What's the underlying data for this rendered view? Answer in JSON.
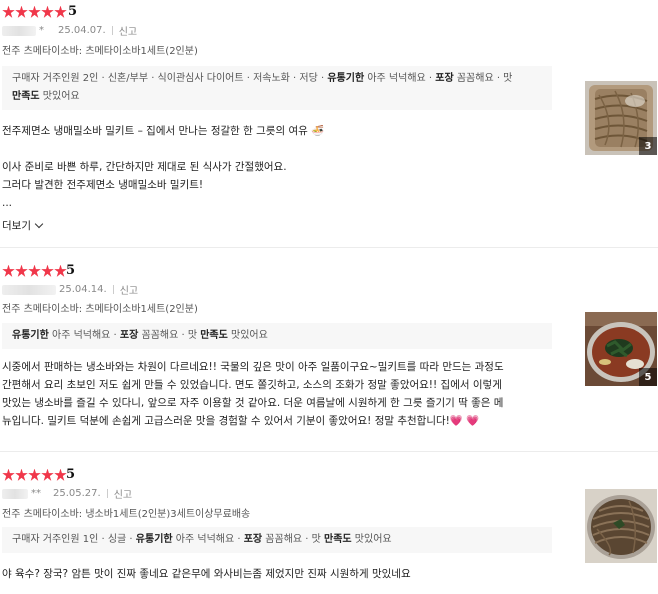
{
  "reviews": [
    {
      "rating": "5",
      "stars": 5,
      "user": "*",
      "date": "25.04.07.",
      "report": "신고",
      "option": "전주 츠메타이소바: 츠메타이소바1세트(2인분)",
      "tags_line1": [
        {
          "text": "구매자 거주인원 2인 · 신혼/부부 · 식이관심사 다이어트 · 저속노화 · 저당 · ",
          "bold": false
        },
        {
          "text": "유통기한",
          "bold": true
        },
        {
          "text": " 아주 넉넉해요 · ",
          "bold": false
        },
        {
          "text": "포장",
          "bold": true
        },
        {
          "text": " 꼼꼼해요 · 맛",
          "bold": false
        }
      ],
      "tags_line2": [
        {
          "text": "만족도",
          "bold": true
        },
        {
          "text": " 맛있어요",
          "bold": false
        }
      ],
      "body": [
        "전주제면소 냉매밀소바 밀키트 – 집에서 만나는 정갈한 한 그릇의 여유 🍜",
        "",
        "이사 준비로 바쁜 하루, 간단하지만 제대로 된 식사가 간절했어요.",
        "그러다 발견한 전주제면소 냉매밀소바 밀키트!",
        "..."
      ],
      "more": "더보기",
      "photo_count": "3"
    },
    {
      "rating": "5",
      "stars": 5,
      "user": "",
      "date": "25.04.14.",
      "report": "신고",
      "option": "전주 츠메타이소바: 츠메타이소바1세트(2인분)",
      "tags_line1": [
        {
          "text": "유통기한",
          "bold": true
        },
        {
          "text": " 아주 넉넉해요 · ",
          "bold": false
        },
        {
          "text": "포장",
          "bold": true
        },
        {
          "text": " 꼼꼼해요 · 맛 ",
          "bold": false
        },
        {
          "text": "만족도",
          "bold": true
        },
        {
          "text": " 맛있어요",
          "bold": false
        }
      ],
      "body": [
        "시중에서 판매하는 냉소바와는 차원이 다르네요!! 국물의 깊은 맛이 아주 일품이구요~밀키트를 따라 만드는 과정도",
        "간편해서 요리 초보인 저도 쉽게 만들 수 있었습니다. 면도 쫄깃하고, 소스의 조화가 정말 좋았어요!! 집에서 이렇게",
        "맛있는 냉소바를 즐길 수 있다니, 앞으로 자주 이용할 것 같아요. 더운 여름날에 시원하게 한 그릇 즐기기 딱 좋은 메",
        "뉴입니다. 밀키트 덕분에 손쉽게 고급스러운 맛을 경험할 수 있어서 기분이 좋았어요! 정말 추천합니다!"
      ],
      "hearts": "💗 💗",
      "photo_count": "5"
    },
    {
      "rating": "5",
      "stars": 5,
      "user": "**",
      "date": "25.05.27.",
      "report": "신고",
      "option": "전주 츠메타이소바: 냉소바1세트(2인분)3세트이상무료배송",
      "tags_line1": [
        {
          "text": "구매자 거주인원 1인 · 싱글 · ",
          "bold": false
        },
        {
          "text": "유통기한",
          "bold": true
        },
        {
          "text": " 아주 넉넉해요 · ",
          "bold": false
        },
        {
          "text": "포장",
          "bold": true
        },
        {
          "text": " 꼼꼼해요 · 맛 ",
          "bold": false
        },
        {
          "text": "만족도",
          "bold": true
        },
        {
          "text": " 맛있어요",
          "bold": false
        }
      ],
      "body": [
        "야 육수? 장국? 암튼 맛이 진짜 좋네요 같은무에 와사비는좀 제었지만 진짜 시원하게 맛있네요"
      ]
    }
  ],
  "colors": {
    "star": "#f0374a",
    "tag_bg": "#f7f7f7",
    "meta": "#888888"
  }
}
